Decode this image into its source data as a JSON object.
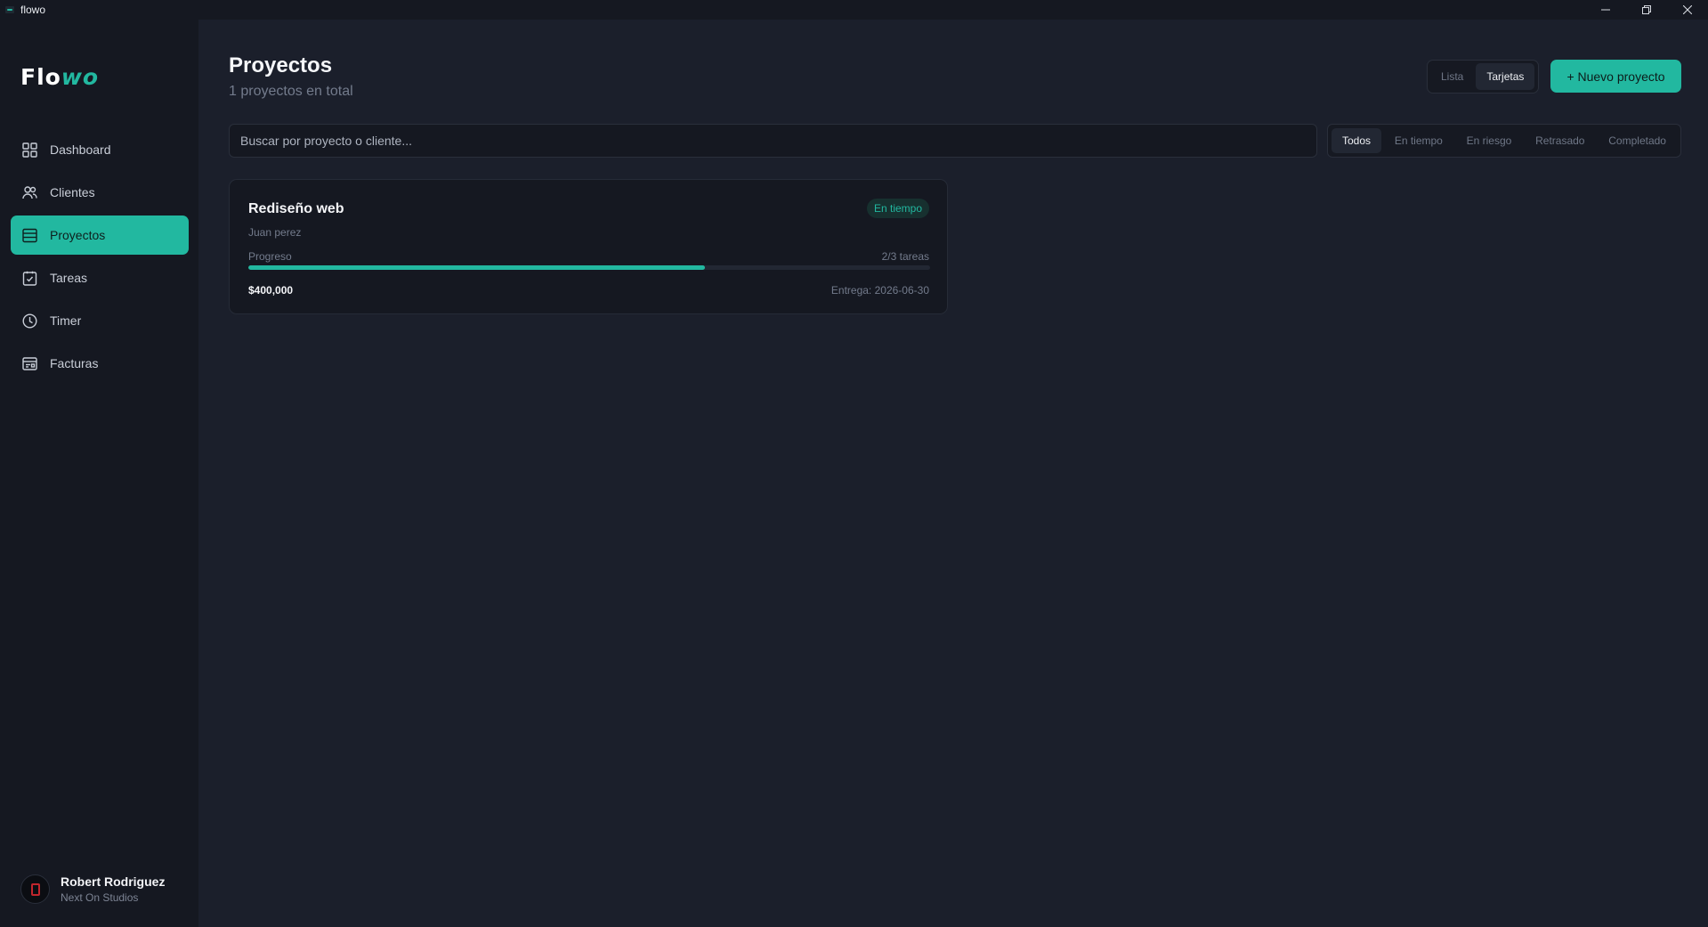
{
  "window": {
    "title": "flowo",
    "controls": [
      "minimize-icon",
      "restore-icon",
      "close-icon"
    ]
  },
  "sidebar": {
    "logo": {
      "part1": "Flo",
      "part2": "wo"
    },
    "items": [
      {
        "label": "Dashboard",
        "icon": "grid-icon",
        "active": false
      },
      {
        "label": "Clientes",
        "icon": "users-icon",
        "active": false
      },
      {
        "label": "Proyectos",
        "icon": "list-icon",
        "active": true
      },
      {
        "label": "Tareas",
        "icon": "clipboard-check-icon",
        "active": false
      },
      {
        "label": "Timer",
        "icon": "clock-icon",
        "active": false
      },
      {
        "label": "Facturas",
        "icon": "invoice-icon",
        "active": false
      }
    ],
    "user": {
      "name": "Robert Rodriguez",
      "org": "Next On Studios"
    }
  },
  "header": {
    "title": "Proyectos",
    "subtitle": "1 proyectos en total",
    "view_options": [
      "Lista",
      "Tarjetas"
    ],
    "active_view": "Tarjetas",
    "new_button": "+ Nuevo proyecto"
  },
  "search": {
    "placeholder": "Buscar por proyecto o cliente...",
    "value": ""
  },
  "filters": {
    "options": [
      "Todos",
      "En tiempo",
      "En riesgo",
      "Retrasado",
      "Completado"
    ],
    "active": "Todos"
  },
  "projects": [
    {
      "name": "Rediseño web",
      "status": "En tiempo",
      "client": "Juan perez",
      "progress_label": "Progreso",
      "tasks": "2/3 tareas",
      "progress_fraction": 0.67,
      "amount": "$400,000",
      "due": "Entrega: 2026-06-30"
    }
  ],
  "colors": {
    "accent": "#22b8a0",
    "background": "#1b1f2b",
    "sidebar": "#151821"
  }
}
